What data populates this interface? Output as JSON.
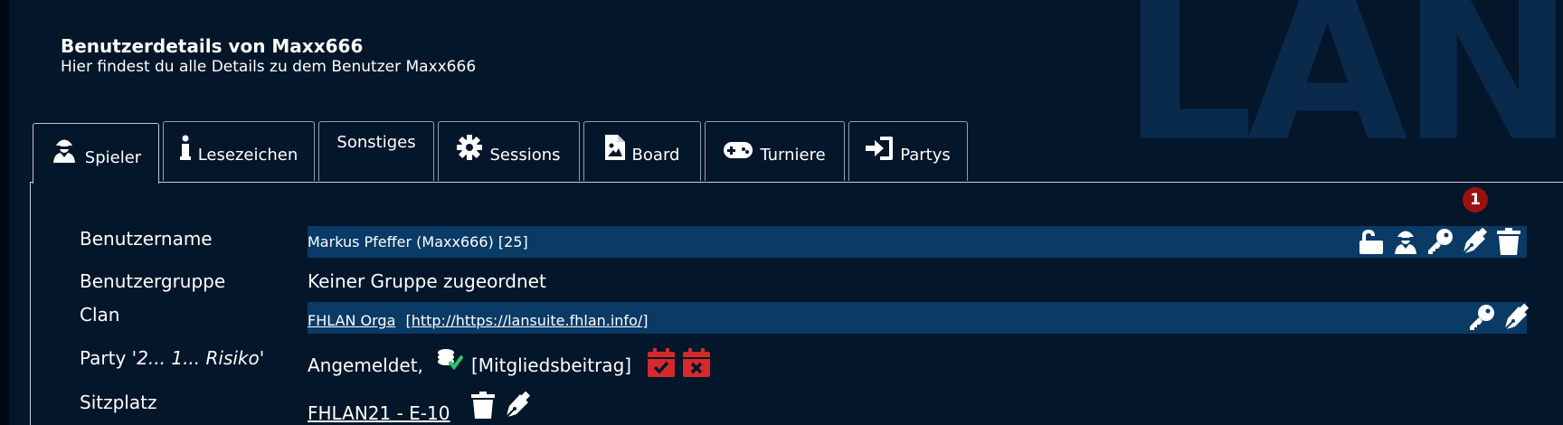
{
  "header": {
    "title": "Benutzerdetails von Maxx666",
    "subtitle": "Hier findest du alle Details zu dem Benutzer Maxx666"
  },
  "watermark": "LAN",
  "tabs": [
    {
      "label": "Spieler",
      "icon": "user-secret-icon",
      "active": true
    },
    {
      "label": "Lesezeichen",
      "icon": "info-icon"
    },
    {
      "label": "Sonstiges",
      "icon": ""
    },
    {
      "label": "Sessions",
      "icon": "gear-icon"
    },
    {
      "label": "Board",
      "icon": "file-image-icon"
    },
    {
      "label": "Turniere",
      "icon": "gamepad-icon"
    },
    {
      "label": "Partys",
      "icon": "sign-in-icon"
    }
  ],
  "badge": "1",
  "rows": {
    "username": {
      "label": "Benutzername",
      "value": "Markus Pfeffer (Maxx666) [25]",
      "icons": [
        "unlock-icon",
        "user-secret-icon",
        "key-icon",
        "pen-icon",
        "trash-icon"
      ]
    },
    "usergroup": {
      "label": "Benutzergruppe",
      "value": "Keiner Gruppe zugeordnet"
    },
    "clan": {
      "label": "Clan",
      "name": "FHLAN Orga",
      "url": "[http://https://lansuite.fhlan.info/]",
      "icons": [
        "key-icon",
        "pen-icon"
      ]
    },
    "party": {
      "label_prefix": "Party '",
      "label_name": "2... 1... Risiko",
      "label_suffix": "'",
      "status": "Angemeldet,",
      "fee": "[Mitgliedsbeitrag]",
      "icons": [
        "coins-check-icon",
        "calendar-check-icon",
        "calendar-times-icon"
      ]
    },
    "seat": {
      "label": "Sitzplatz",
      "value": "FHLAN21 - E-10",
      "icons": [
        "trash-icon",
        "pen-icon"
      ]
    }
  },
  "colors": {
    "background": "#03162a",
    "row_highlight": "#0a3a66",
    "badge": "#9b1010",
    "calendar_red": "#d42a2a",
    "coin_check_green": "#27c46b"
  }
}
